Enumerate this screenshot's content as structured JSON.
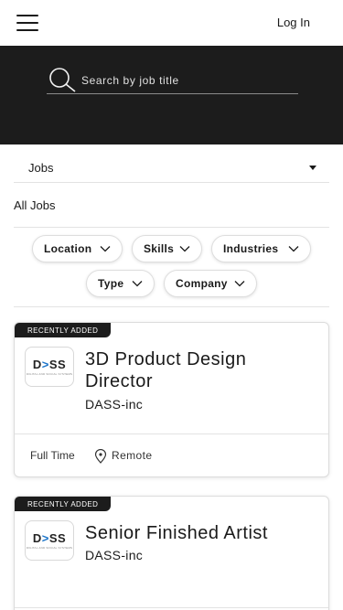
{
  "header": {
    "menu_icon": "hamburger-icon",
    "login_label": "Log In"
  },
  "search": {
    "placeholder": "Search by job title",
    "icon": "search-icon"
  },
  "filters": {
    "jobs_select_value": "Jobs",
    "all_jobs_label": "All Jobs",
    "chips": [
      {
        "label": "Location"
      },
      {
        "label": "Skills"
      },
      {
        "label": "Industries"
      },
      {
        "label": "Type"
      },
      {
        "label": "Company"
      }
    ]
  },
  "jobs": [
    {
      "badge": "RECENTLY ADDED",
      "logo_text": "DASS",
      "title_line1": "3D Product Design",
      "title_line2": "Director",
      "company": "DASS-inc",
      "job_type": "Full Time",
      "location": "Remote"
    },
    {
      "badge": "RECENTLY ADDED",
      "logo_text": "DASS",
      "title_line1": "Senior Finished Artist",
      "company": "DASS-inc"
    }
  ],
  "colors": {
    "hero_bg": "#1c1c1c",
    "logo_accent": "#1a73c8"
  }
}
